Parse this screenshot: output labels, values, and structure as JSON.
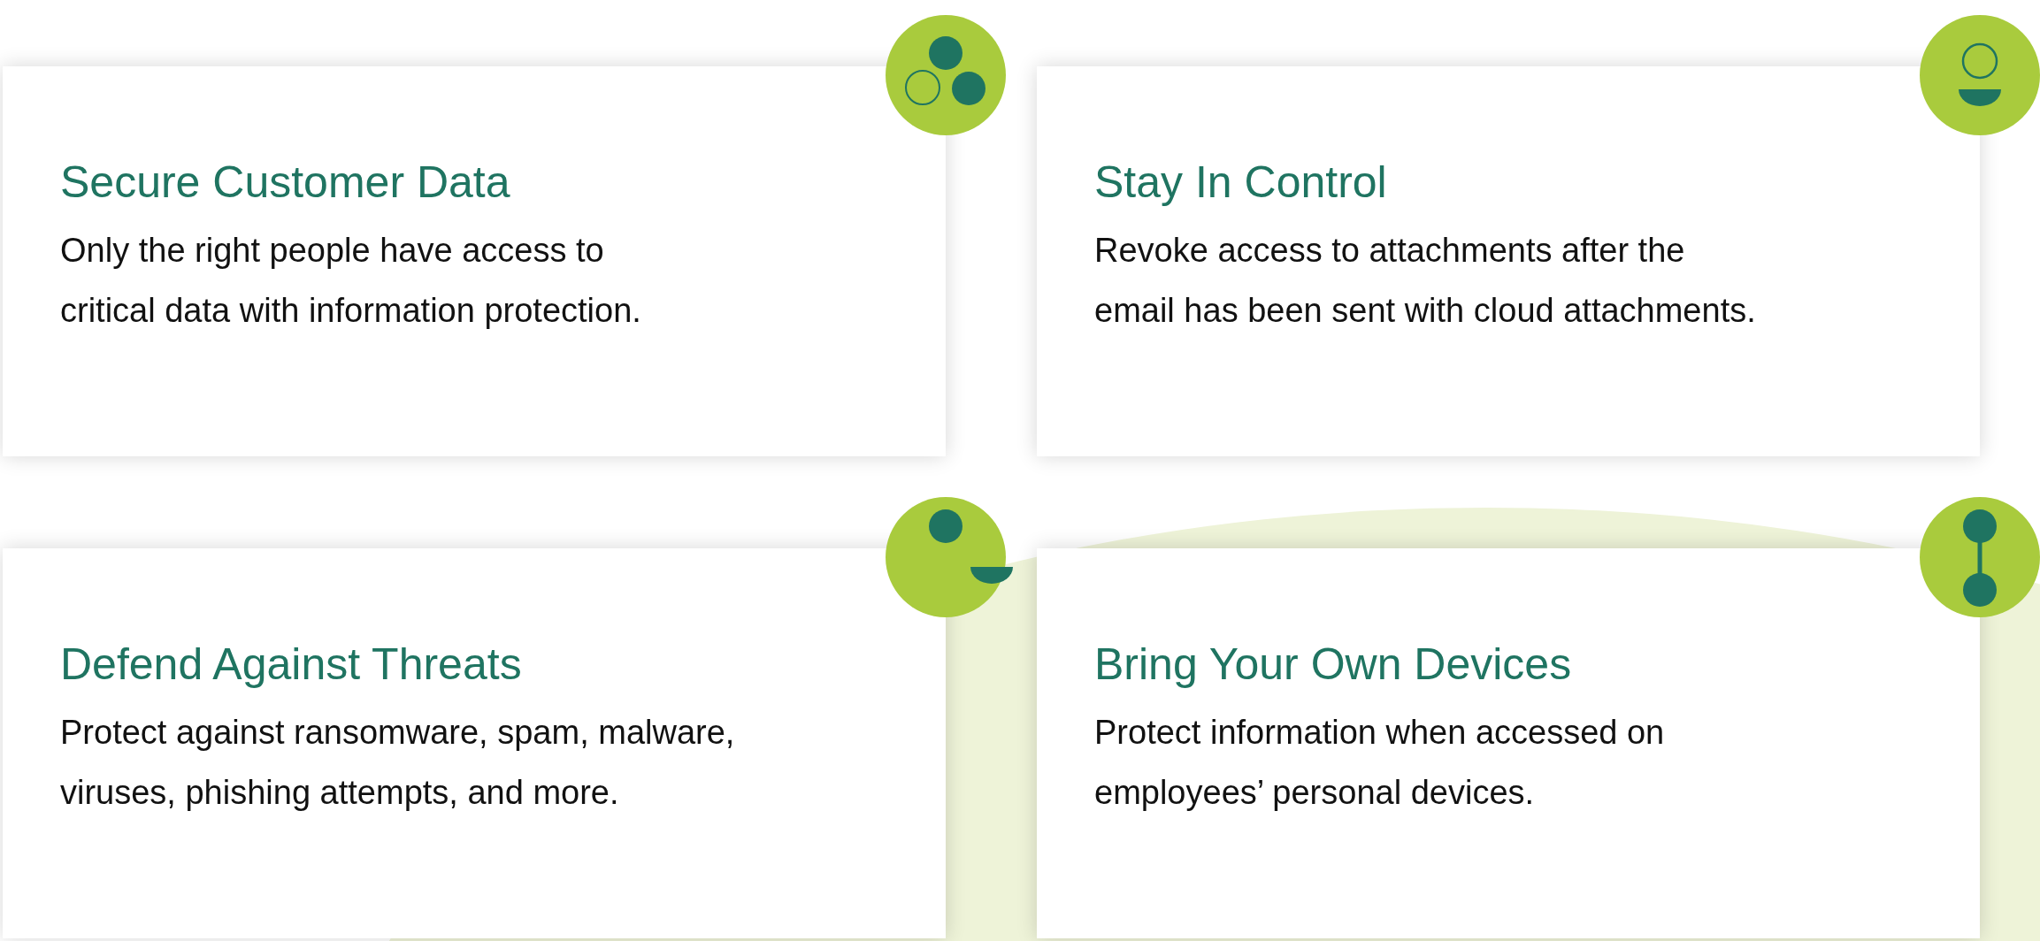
{
  "cards": [
    {
      "title": "Secure Customer Data",
      "lines": [
        "Only the right people have access to",
        "critical data with information protection."
      ]
    },
    {
      "title": "Stay In Control",
      "lines": [
        "Revoke access to attachments after the",
        "email has been sent with cloud attachments."
      ]
    },
    {
      "title": "Defend Against Threats",
      "lines": [
        "Protect against ransomware, spam, malware,",
        "viruses, phishing attempts, and more."
      ]
    },
    {
      "title": "Bring Your Own Devices",
      "lines": [
        "Protect information when accessed on",
        "employees’ personal devices."
      ]
    }
  ]
}
